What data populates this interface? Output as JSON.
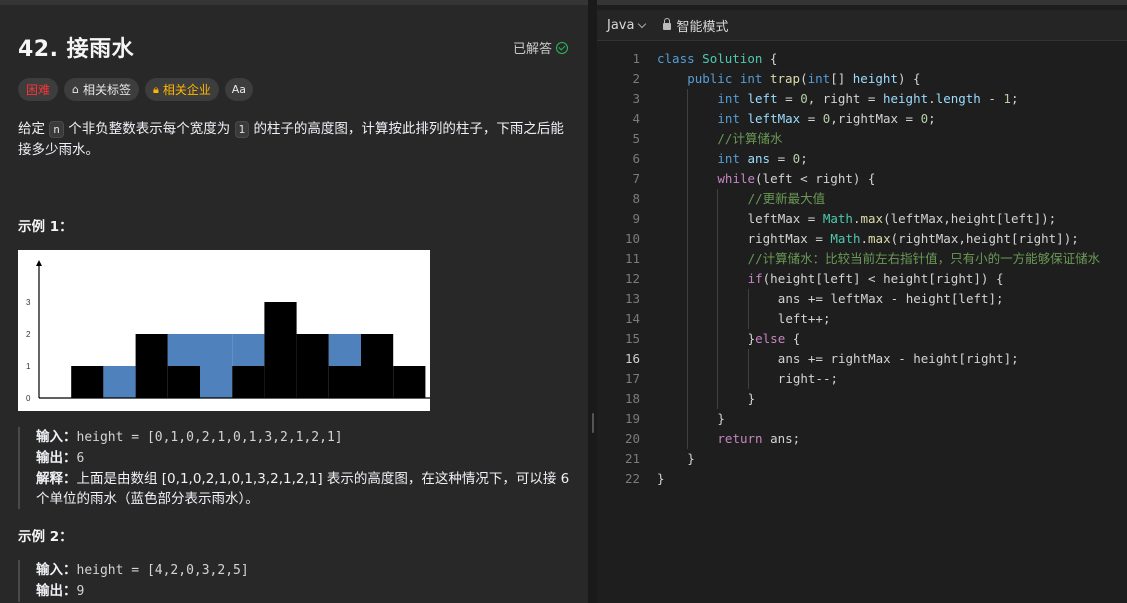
{
  "problem": {
    "title": "42. 接雨水",
    "solved_label": "已解答",
    "tags": {
      "difficulty": "困难",
      "topics": "相关标签",
      "companies": "相关企业",
      "font_icon": "Aa"
    },
    "description": {
      "p1": "给定",
      "n": "n",
      "p2": "个非负整数表示每个宽度为",
      "one": "1",
      "p3": "的柱子的高度图，计算按此排列的柱子，下雨之后能接多少雨水。"
    }
  },
  "example1": {
    "heading": "示例 1：",
    "input_label": "输入：",
    "input_value": "height = [0,1,0,2,1,0,1,3,2,1,2,1]",
    "output_label": "输出：",
    "output_value": "6",
    "explain_label": "解释：",
    "explain_text": "上面是由数组 [0,1,0,2,1,0,1,3,2,1,2,1] 表示的高度图，在这种情况下，可以接 6 个单位的雨水（蓝色部分表示雨水）。"
  },
  "example2": {
    "heading": "示例 2：",
    "input_label": "输入：",
    "input_value": "height = [4,2,0,3,2,5]",
    "output_label": "输出：",
    "output_value": "9"
  },
  "figure": {
    "heights": [
      0,
      1,
      0,
      2,
      1,
      0,
      1,
      3,
      2,
      1,
      2,
      1
    ],
    "water": [
      0,
      0,
      1,
      0,
      1,
      2,
      1,
      0,
      0,
      1,
      0,
      0
    ],
    "y_ticks": [
      "0",
      "1",
      "2",
      "3"
    ],
    "bar_color": "#000000",
    "water_color": "#4f81bd"
  },
  "editor": {
    "language": "Java",
    "mode": "智能模式",
    "active_line": 16,
    "lines": [
      {
        "n": "1",
        "indent": 0,
        "tokens": [
          [
            "kw",
            "class"
          ],
          [
            "pl",
            " "
          ],
          [
            "ty",
            "Solution"
          ],
          [
            "pl",
            " {"
          ]
        ]
      },
      {
        "n": "2",
        "indent": 1,
        "tokens": [
          [
            "kw",
            "public"
          ],
          [
            "pl",
            " "
          ],
          [
            "kw",
            "int"
          ],
          [
            "pl",
            " "
          ],
          [
            "fn",
            "trap"
          ],
          [
            "pl",
            "("
          ],
          [
            "kw",
            "int"
          ],
          [
            "pl",
            "[] "
          ],
          [
            "var",
            "height"
          ],
          [
            "pl",
            ") {"
          ]
        ]
      },
      {
        "n": "3",
        "indent": 2,
        "tokens": [
          [
            "kw",
            "int"
          ],
          [
            "pl",
            " "
          ],
          [
            "var",
            "left"
          ],
          [
            "pl",
            " = "
          ],
          [
            "num",
            "0"
          ],
          [
            "pl",
            ", right = "
          ],
          [
            "var",
            "height"
          ],
          [
            "pl",
            "."
          ],
          [
            "var",
            "length"
          ],
          [
            "pl",
            " - "
          ],
          [
            "num",
            "1"
          ],
          [
            "pl",
            ";"
          ]
        ]
      },
      {
        "n": "4",
        "indent": 2,
        "tokens": [
          [
            "kw",
            "int"
          ],
          [
            "pl",
            " "
          ],
          [
            "var",
            "leftMax"
          ],
          [
            "pl",
            " = "
          ],
          [
            "num",
            "0"
          ],
          [
            "pl",
            ",rightMax = "
          ],
          [
            "num",
            "0"
          ],
          [
            "pl",
            ";"
          ]
        ]
      },
      {
        "n": "5",
        "indent": 2,
        "tokens": [
          [
            "cm",
            "//计算储水"
          ]
        ]
      },
      {
        "n": "6",
        "indent": 2,
        "tokens": [
          [
            "kw",
            "int"
          ],
          [
            "pl",
            " "
          ],
          [
            "var",
            "ans"
          ],
          [
            "pl",
            " = "
          ],
          [
            "num",
            "0"
          ],
          [
            "pl",
            ";"
          ]
        ]
      },
      {
        "n": "7",
        "indent": 2,
        "tokens": [
          [
            "ctl",
            "while"
          ],
          [
            "pl",
            "(left < right) {"
          ]
        ]
      },
      {
        "n": "8",
        "indent": 3,
        "tokens": [
          [
            "cm",
            "//更新最大值"
          ]
        ]
      },
      {
        "n": "9",
        "indent": 3,
        "tokens": [
          [
            "pl",
            "leftMax = "
          ],
          [
            "ty",
            "Math"
          ],
          [
            "pl",
            "."
          ],
          [
            "fn",
            "max"
          ],
          [
            "pl",
            "(leftMax,height[left]);"
          ]
        ]
      },
      {
        "n": "10",
        "indent": 3,
        "tokens": [
          [
            "pl",
            "rightMax = "
          ],
          [
            "ty",
            "Math"
          ],
          [
            "pl",
            "."
          ],
          [
            "fn",
            "max"
          ],
          [
            "pl",
            "(rightMax,height[right]);"
          ]
        ]
      },
      {
        "n": "11",
        "indent": 3,
        "tokens": [
          [
            "cm",
            "//计算储水：比较当前左右指针值，只有小的一方能够保证储水"
          ]
        ]
      },
      {
        "n": "12",
        "indent": 3,
        "tokens": [
          [
            "ctl",
            "if"
          ],
          [
            "pl",
            "(height[left] < height[right]) {"
          ]
        ]
      },
      {
        "n": "13",
        "indent": 4,
        "tokens": [
          [
            "pl",
            "ans += leftMax - height[left];"
          ]
        ]
      },
      {
        "n": "14",
        "indent": 4,
        "tokens": [
          [
            "pl",
            "left++;"
          ]
        ]
      },
      {
        "n": "15",
        "indent": 3,
        "tokens": [
          [
            "pl",
            "}"
          ],
          [
            "ctl",
            "else"
          ],
          [
            "pl",
            " {"
          ]
        ]
      },
      {
        "n": "16",
        "indent": 4,
        "tokens": [
          [
            "pl",
            "ans += rightMax - height[right];"
          ]
        ]
      },
      {
        "n": "17",
        "indent": 4,
        "tokens": [
          [
            "pl",
            "right--;"
          ]
        ]
      },
      {
        "n": "18",
        "indent": 3,
        "tokens": [
          [
            "pl",
            "}"
          ]
        ]
      },
      {
        "n": "19",
        "indent": 2,
        "tokens": [
          [
            "pl",
            "}"
          ]
        ]
      },
      {
        "n": "20",
        "indent": 2,
        "tokens": [
          [
            "ctl",
            "return"
          ],
          [
            "pl",
            " ans;"
          ]
        ]
      },
      {
        "n": "21",
        "indent": 1,
        "tokens": [
          [
            "pl",
            "}"
          ]
        ]
      },
      {
        "n": "22",
        "indent": 0,
        "tokens": [
          [
            "pl",
            "}"
          ]
        ]
      }
    ]
  }
}
